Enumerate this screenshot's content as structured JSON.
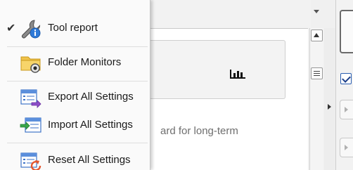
{
  "menu": {
    "items": [
      {
        "label": "Tool report",
        "icon": "wrench-info-icon",
        "checked": true
      },
      {
        "label": "Folder Monitors",
        "icon": "folder-monitor-icon",
        "checked": false
      },
      {
        "label": "Export All Settings",
        "icon": "export-settings-icon",
        "checked": false
      },
      {
        "label": "Import All Settings",
        "icon": "import-settings-icon",
        "checked": false
      },
      {
        "label": "Reset All Settings",
        "icon": "reset-settings-icon",
        "checked": false
      }
    ]
  },
  "main": {
    "partial_text": "ard for long-term",
    "box_icon": "bar-chart-icon"
  },
  "colors": {
    "folder": "#f0c24a",
    "info_blue": "#2f7ad8",
    "checkbox_blue": "#2a5db0"
  }
}
